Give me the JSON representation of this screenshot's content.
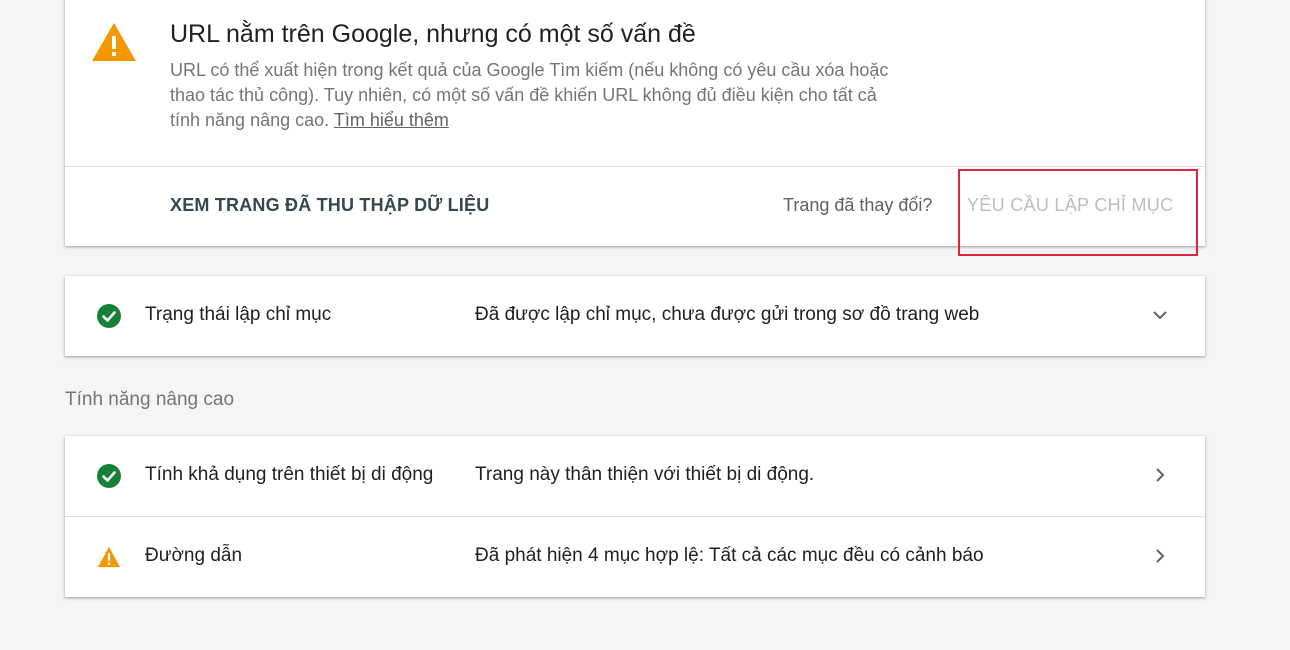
{
  "verdict": {
    "title": "URL nằm trên Google, nhưng có một số vấn đề",
    "description": "URL có thể xuất hiện trong kết quả của Google Tìm kiếm (nếu không có yêu cầu xóa hoặc thao tác thủ công). Tuy nhiên, có một số vấn đề khiến URL không đủ điều kiện cho tất cả tính năng nâng cao.",
    "learn_more": "Tìm hiểu thêm",
    "icon": "warning-icon",
    "warning_color": "#f29900"
  },
  "actions": {
    "view_crawled": "XEM TRANG ĐÃ THU THẬP DỮ LIỆU",
    "changed_question": "Trang đã thay đổi?",
    "request_indexing": "YÊU CẦU LẬP CHỈ MỤC",
    "highlight_color": "#e0243c"
  },
  "index_status": {
    "label": "Trạng thái lập chỉ mục",
    "value": "Đã được lập chỉ mục, chưa được gửi trong sơ đồ trang web",
    "icon": "check-circle-icon",
    "action_icon": "chevron-down-icon",
    "success_color": "#188038"
  },
  "enhancements": {
    "heading": "Tính năng nâng cao",
    "items": [
      {
        "label": "Tính khả dụng trên thiết bị di động",
        "value": "Trang này thân thiện với thiết bị di động.",
        "icon": "check-circle-icon",
        "action_icon": "chevron-right-icon"
      },
      {
        "label": "Đường dẫn",
        "value": "Đã phát hiện 4 mục hợp lệ: Tất cả các mục đều có cảnh báo",
        "icon": "warning-icon",
        "action_icon": "chevron-right-icon"
      }
    ]
  }
}
